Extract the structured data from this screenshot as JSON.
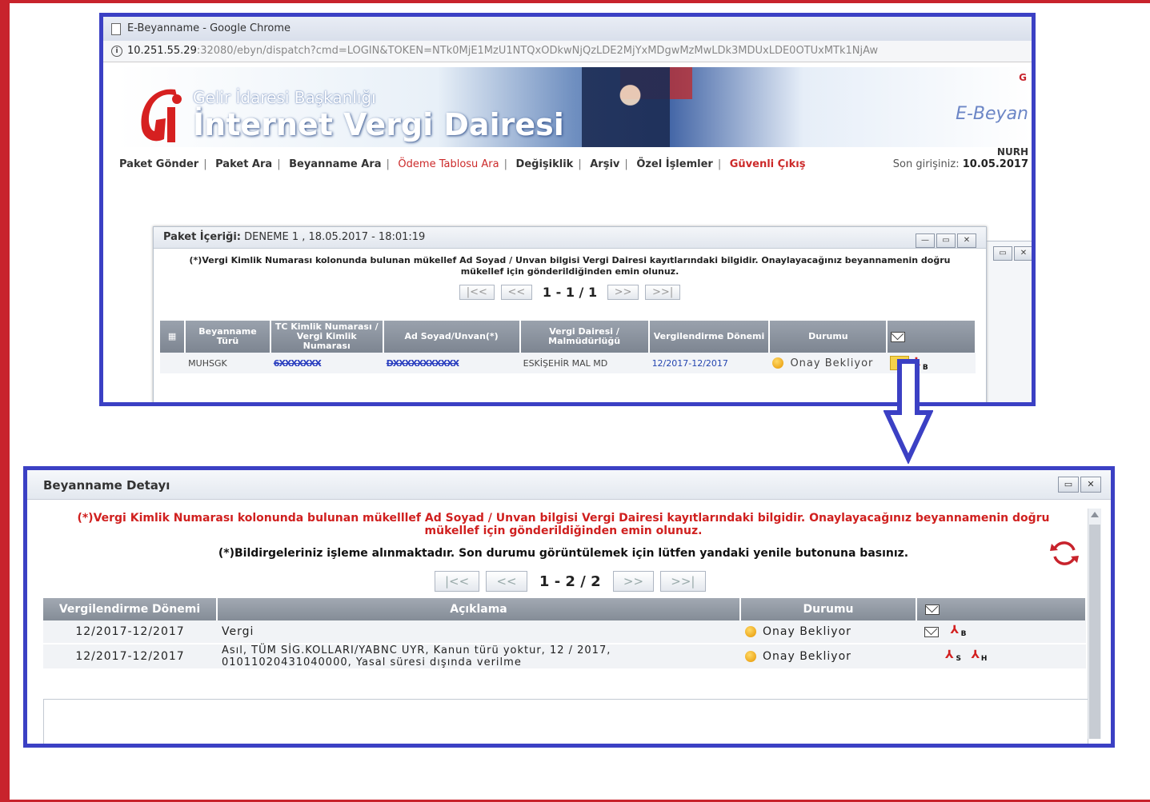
{
  "browser": {
    "title": "E-Beyanname - Google Chrome",
    "url_host": "10.251.55.29",
    "url_rest": ":32080/ebyn/dispatch?cmd=LOGIN&TOKEN=NTk0MjE1MzU1NTQxODkwNjQzLDE2MjYxMDgwMzMwLDk3MDUxLDE0OTUxMTk1NjAw"
  },
  "banner": {
    "subtitle": "Gelir İdaresi Başkanlığı",
    "title": "İnternet Vergi Dairesi",
    "app_name": "E-Beyan",
    "corner_text": "G"
  },
  "nav": {
    "items": [
      "Paket Gönder",
      "Paket Ara",
      "Beyanname Ara",
      "Ödeme Tablosu Ara",
      "Değişiklik",
      "Arşiv",
      "Özel İşlemler",
      "Güvenli Çıkış"
    ],
    "user": "NURH",
    "last_login_label": "Son girişiniz:",
    "last_login_value": "10.05.2017"
  },
  "paket": {
    "title_label": "Paket İçeriği:",
    "title_value": "DENEME 1 , 18.05.2017 - 18:01:19",
    "warning": "(*)Vergi Kimlik Numarası kolonunda bulunan mükellef Ad Soyad / Unvan bilgisi Vergi Dairesi kayıtlarındaki bilgidir. Onaylayacağınız beyannamenin doğru mükellef için gönderildiğinden emin olunuz.",
    "pager": {
      "first": "|<<",
      "prev": "<<",
      "page": "1 - 1 / 1",
      "next": ">>",
      "last": ">>|"
    },
    "columns": [
      "Beyanname Türü",
      "TC Kimlik Numarası / Vergi Kimlik Numarası",
      "Ad Soyad/Unvan(*)",
      "Vergi Dairesi / Malmüdürlüğü",
      "Vergilendirme Dönemi",
      "Durumu"
    ],
    "row": {
      "type": "MUHSGK",
      "tckn": "6XXXXXXX",
      "name": "DXXXXXXXXXXX",
      "office": "ESKİŞEHİR MAL MD",
      "period": "12/2017-12/2017",
      "status": "Onay Bekliyor"
    }
  },
  "detail": {
    "title": "Beyanname Detayı",
    "warning": "(*)Vergi Kimlik Numarası kolonunda bulunan mükelllef Ad Soyad / Unvan bilgisi Vergi Dairesi kayıtlarındaki bilgidir. Onaylayacağınız beyannamenin doğru mükellef için gönderildiğinden emin olunuz.",
    "info": "(*)Bildirgeleriniz işleme alınmaktadır. Son durumu görüntülemek için lütfen yandaki yenile butonuna basınız.",
    "pager": {
      "first": "|<<",
      "prev": "<<",
      "page": "1 - 2 / 2",
      "next": ">>",
      "last": ">>|"
    },
    "columns": [
      "Vergilendirme Dönemi",
      "Açıklama",
      "Durumu"
    ],
    "rows": [
      {
        "period": "12/2017-12/2017",
        "desc": "Vergi",
        "status": "Onay Bekliyor"
      },
      {
        "period": "12/2017-12/2017",
        "desc": "Asıl, TÜM SİG.KOLLARI/YABNC UYR, Kanun türü yoktur, 12 / 2017, 01011020431040000, Yasal süresi dışında verilme",
        "status": "Onay Bekliyor"
      }
    ]
  },
  "colors": {
    "frame_red": "#c8232c",
    "highlight_blue": "#3b40c4",
    "warning_red": "#d0201f"
  }
}
